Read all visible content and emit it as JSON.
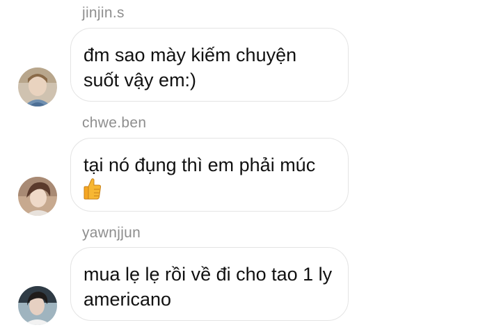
{
  "messages": [
    {
      "username": "jinjin.s",
      "text": "đm sao mày kiếm chuyện suốt vậy em:)",
      "avatar": "avatar-jinjin"
    },
    {
      "username": "chwe.ben",
      "text": "tại nó đụng thì em phải múc",
      "emoji": "thumbs-up-icon",
      "avatar": "avatar-chwe"
    },
    {
      "username": "yawnjjun",
      "text": "mua lẹ lẹ rồi về đi cho tao 1 ly americano",
      "avatar": "avatar-yawn"
    }
  ],
  "colors": {
    "username": "#8e8e8e",
    "bubble_border": "#e4e4e4",
    "text": "#111111",
    "emoji_yellow": "#f7b733"
  }
}
